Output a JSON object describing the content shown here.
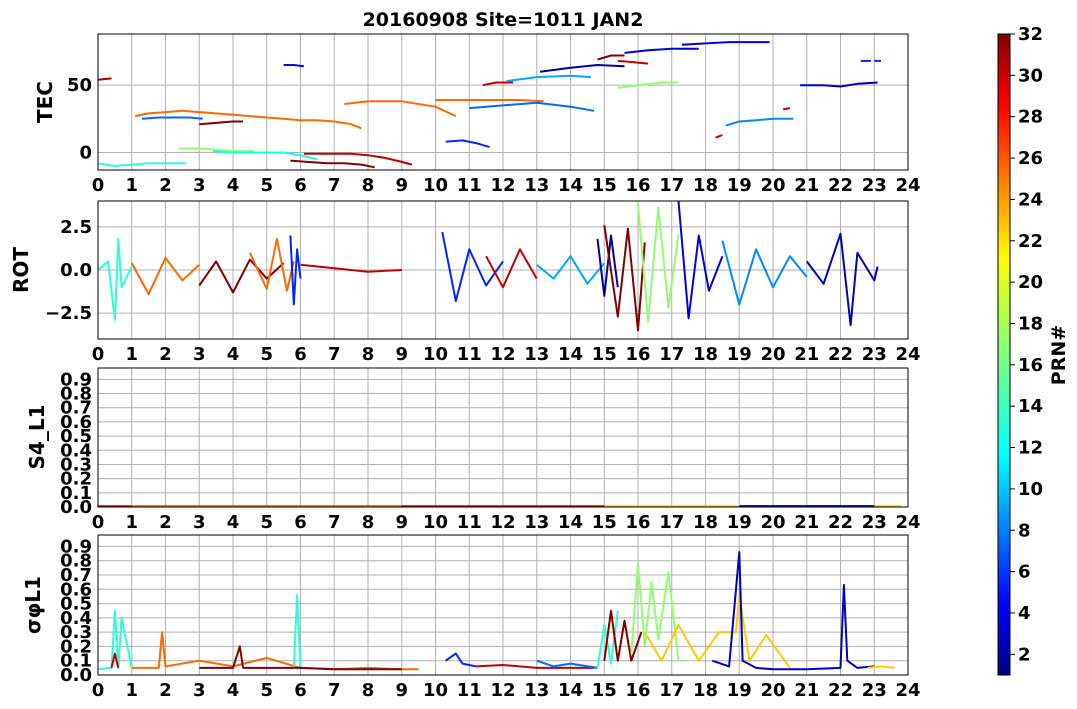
{
  "title": "20160908 Site=1011 JAN2",
  "colorbar": {
    "label": "PRN#",
    "range": [
      1,
      32
    ],
    "ticks": [
      "2",
      "4",
      "6",
      "8",
      "10",
      "12",
      "14",
      "16",
      "18",
      "20",
      "22",
      "24",
      "26",
      "28",
      "30",
      "32"
    ],
    "colormap": "jet"
  },
  "chart_data": [
    {
      "type": "line",
      "ylabel": "TEC",
      "xlim": [
        0,
        24
      ],
      "ylim": [
        -13,
        88
      ],
      "grid": true,
      "xticks": [
        "0",
        "1",
        "2",
        "3",
        "4",
        "5",
        "6",
        "7",
        "8",
        "9",
        "10",
        "11",
        "12",
        "13",
        "14",
        "15",
        "16",
        "17",
        "18",
        "19",
        "20",
        "21",
        "22",
        "23",
        "24"
      ],
      "yticks": [
        "0",
        "50"
      ],
      "ytick_values": [
        0,
        50
      ],
      "series": [
        {
          "prn": 31,
          "x": [
            0,
            0.4
          ],
          "y": [
            54,
            55
          ]
        },
        {
          "prn": 14,
          "x": [
            0,
            0.5,
            1,
            1.5,
            2,
            2.6
          ],
          "y": [
            -8,
            -10,
            -9,
            -8,
            -8,
            -8
          ]
        },
        {
          "prn": 25,
          "x": [
            1.1,
            1.5,
            2,
            2.5,
            3,
            3.5,
            4,
            4.5,
            5,
            5.5,
            6,
            6.5,
            7,
            7.5,
            7.8
          ],
          "y": [
            27,
            29,
            30,
            31,
            30,
            29,
            28,
            27,
            26,
            25,
            24,
            24,
            23,
            21,
            18
          ]
        },
        {
          "prn": 8,
          "x": [
            1.3,
            1.8,
            2.3,
            2.7,
            3.1
          ],
          "y": [
            25,
            26,
            26,
            26,
            25
          ]
        },
        {
          "prn": 32,
          "x": [
            3,
            3.5,
            4,
            4.3
          ],
          "y": [
            21,
            22,
            23,
            23
          ]
        },
        {
          "prn": 17,
          "x": [
            2.4,
            3,
            3.5,
            4,
            4.6
          ],
          "y": [
            3,
            3,
            2,
            1,
            1
          ]
        },
        {
          "prn": 13,
          "x": [
            3.4,
            4,
            5,
            5.5,
            6,
            6.5
          ],
          "y": [
            1,
            0,
            0,
            0,
            -2,
            -5
          ]
        },
        {
          "prn": 5,
          "x": [
            5.5,
            5.8,
            6.1
          ],
          "y": [
            65,
            65,
            64
          ]
        },
        {
          "prn": 32,
          "x": [
            5.7,
            6.2,
            6.8,
            7.3,
            7.8,
            8.2
          ],
          "y": [
            -6,
            -7,
            -8,
            -8,
            -9,
            -11
          ]
        },
        {
          "prn": 30,
          "x": [
            6.1,
            6.5,
            7,
            7.5,
            8,
            8.5,
            9,
            9.3
          ],
          "y": [
            -1,
            -1,
            -1,
            -1,
            -2,
            -4,
            -7,
            -9
          ]
        },
        {
          "prn": 25,
          "x": [
            7.3,
            8,
            9,
            10,
            10.6
          ],
          "y": [
            36,
            38,
            38,
            34,
            27
          ]
        },
        {
          "prn": 6,
          "x": [
            10.3,
            10.8,
            11.2,
            11.6
          ],
          "y": [
            8,
            9,
            7,
            4
          ]
        },
        {
          "prn": 25,
          "x": [
            10,
            11,
            12.5,
            13.2
          ],
          "y": [
            39,
            39,
            39,
            38
          ]
        },
        {
          "prn": 8,
          "x": [
            11,
            12,
            13,
            14,
            14.7
          ],
          "y": [
            33,
            35,
            37,
            34,
            31
          ]
        },
        {
          "prn": 30,
          "x": [
            11.4,
            11.8,
            12.3
          ],
          "y": [
            50,
            52,
            52
          ]
        },
        {
          "prn": 10,
          "x": [
            12.1,
            13,
            14,
            14.6
          ],
          "y": [
            53,
            56,
            57,
            56
          ]
        },
        {
          "prn": 2,
          "x": [
            13.1,
            14,
            14.8,
            15.6
          ],
          "y": [
            60,
            63,
            65,
            64
          ]
        },
        {
          "prn": 32,
          "x": [
            14.8,
            15.2,
            15.6
          ],
          "y": [
            69,
            72,
            72
          ]
        },
        {
          "prn": 30,
          "x": [
            15.4,
            15.9,
            16.3
          ],
          "y": [
            68,
            67,
            66
          ]
        },
        {
          "prn": 4,
          "x": [
            15.6,
            16.3,
            17,
            17.8
          ],
          "y": [
            74,
            76,
            77,
            77
          ]
        },
        {
          "prn": 17,
          "x": [
            15.4,
            16,
            16.7,
            17.2
          ],
          "y": [
            48,
            50,
            52,
            52
          ]
        },
        {
          "prn": 4,
          "x": [
            17.3,
            18,
            18.7,
            19.3,
            19.9
          ],
          "y": [
            80,
            81,
            82,
            82,
            82
          ]
        },
        {
          "prn": 30,
          "x": [
            18.3,
            18.5
          ],
          "y": [
            11,
            13
          ]
        },
        {
          "prn": 9,
          "x": [
            18.6,
            19,
            19.5,
            20,
            20.6
          ],
          "y": [
            20,
            23,
            24,
            25,
            25
          ]
        },
        {
          "prn": 30,
          "x": [
            20.3,
            20.5
          ],
          "y": [
            32,
            33
          ]
        },
        {
          "prn": 3,
          "x": [
            20.8,
            21.5,
            22,
            22.5,
            23.1
          ],
          "y": [
            50,
            50,
            49,
            51,
            52
          ]
        },
        {
          "prn": 6,
          "x": [
            22.6,
            22.9
          ],
          "y": [
            68,
            68
          ]
        },
        {
          "prn": 6,
          "x": [
            23,
            23.2
          ],
          "y": [
            68,
            68
          ]
        }
      ]
    },
    {
      "type": "line",
      "ylabel": "ROT",
      "xlim": [
        0,
        24
      ],
      "ylim": [
        -4,
        4
      ],
      "grid": true,
      "xticks": [
        "0",
        "1",
        "2",
        "3",
        "4",
        "5",
        "6",
        "7",
        "8",
        "9",
        "10",
        "11",
        "12",
        "13",
        "14",
        "15",
        "16",
        "17",
        "18",
        "19",
        "20",
        "21",
        "22",
        "23",
        "24"
      ],
      "yticks": [
        "2.5",
        "0.0",
        "−2.5"
      ],
      "ytick_values": [
        2.5,
        0,
        -2.5
      ],
      "series": [
        {
          "prn": 14,
          "x": [
            0,
            0.3,
            0.5,
            0.6,
            0.7,
            1
          ],
          "y": [
            0,
            0.5,
            -2.9,
            1.8,
            -1,
            0.2
          ]
        },
        {
          "prn": 25,
          "x": [
            1,
            1.5,
            2,
            2.5,
            3
          ],
          "y": [
            0.4,
            -1.4,
            0.7,
            -0.6,
            0.3
          ]
        },
        {
          "prn": 32,
          "x": [
            3,
            3.5,
            4,
            4.5,
            5,
            5.5
          ],
          "y": [
            -0.9,
            0.5,
            -1.3,
            0.6,
            -0.5,
            0.4
          ]
        },
        {
          "prn": 25,
          "x": [
            4.5,
            5,
            5.3,
            5.6,
            5.8
          ],
          "y": [
            1,
            -1.1,
            1.8,
            -1.2,
            0.5
          ]
        },
        {
          "prn": 6,
          "x": [
            5.7,
            5.8,
            5.9,
            6
          ],
          "y": [
            2,
            -2,
            1.2,
            -0.5
          ]
        },
        {
          "prn": 30,
          "x": [
            6,
            7,
            8,
            9
          ],
          "y": [
            0.3,
            0.1,
            -0.1,
            0
          ]
        },
        {
          "prn": 6,
          "x": [
            10.2,
            10.6,
            11,
            11.5,
            12
          ],
          "y": [
            2.2,
            -1.8,
            1.2,
            -0.9,
            0.5
          ]
        },
        {
          "prn": 30,
          "x": [
            11.5,
            12,
            12.5,
            13
          ],
          "y": [
            0.8,
            -1,
            1.2,
            -0.5
          ]
        },
        {
          "prn": 10,
          "x": [
            13,
            13.5,
            14,
            14.5,
            15
          ],
          "y": [
            0.3,
            -0.5,
            0.8,
            -0.8,
            0.4
          ]
        },
        {
          "prn": 2,
          "x": [
            14.8,
            15,
            15.2,
            15.4
          ],
          "y": [
            1.8,
            -1.5,
            2,
            -1
          ]
        },
        {
          "prn": 32,
          "x": [
            15,
            15.4,
            15.7,
            16,
            16.2
          ],
          "y": [
            2.6,
            -2.7,
            2.4,
            -3.5,
            1.6
          ]
        },
        {
          "prn": 17,
          "x": [
            16,
            16.3,
            16.6,
            16.9,
            17.2
          ],
          "y": [
            3.8,
            -3,
            3.6,
            -2.2,
            2.1
          ]
        },
        {
          "prn": 4,
          "x": [
            17.2,
            17.5,
            17.8,
            18.1,
            18.5
          ],
          "y": [
            4,
            -2.8,
            2,
            -1.2,
            0.8
          ]
        },
        {
          "prn": 9,
          "x": [
            18.5,
            19,
            19.5,
            20,
            20.5,
            21
          ],
          "y": [
            1.7,
            -2,
            1.2,
            -1,
            0.8,
            -0.4
          ]
        },
        {
          "prn": 3,
          "x": [
            21,
            21.5,
            22,
            22.3,
            22.5,
            23,
            23.1
          ],
          "y": [
            0.5,
            -0.8,
            2.1,
            -3.2,
            1,
            -0.6,
            0.2
          ]
        }
      ]
    },
    {
      "type": "line",
      "ylabel": "S4_L1",
      "xlim": [
        0,
        24
      ],
      "ylim": [
        0,
        0.98
      ],
      "grid": true,
      "xticks": [
        "0",
        "1",
        "2",
        "3",
        "4",
        "5",
        "6",
        "7",
        "8",
        "9",
        "10",
        "11",
        "12",
        "13",
        "14",
        "15",
        "16",
        "17",
        "18",
        "19",
        "20",
        "21",
        "22",
        "23",
        "24"
      ],
      "yticks": [
        "0.0",
        "0.1",
        "0.2",
        "0.3",
        "0.4",
        "0.5",
        "0.6",
        "0.7",
        "0.8",
        "0.9"
      ],
      "ytick_values": [
        0,
        0.1,
        0.2,
        0.3,
        0.4,
        0.5,
        0.6,
        0.7,
        0.8,
        0.9
      ],
      "series": [
        {
          "prn": 30,
          "x": [
            0,
            4,
            8,
            12,
            15
          ],
          "y": [
            0.005,
            0.005,
            0.005,
            0.005,
            0.005
          ]
        },
        {
          "prn": 25,
          "x": [
            1,
            5,
            9
          ],
          "y": [
            0.004,
            0.004,
            0.004
          ]
        },
        {
          "prn": 22,
          "x": [
            15,
            17,
            19,
            21,
            23,
            23.8
          ],
          "y": [
            0.005,
            0.005,
            0.005,
            0.005,
            0.005,
            0.005
          ]
        },
        {
          "prn": 3,
          "x": [
            19,
            21,
            23
          ],
          "y": [
            0.006,
            0.006,
            0.006
          ]
        }
      ]
    },
    {
      "type": "line",
      "ylabel": "σφL1",
      "xlim": [
        0,
        24
      ],
      "ylim": [
        0,
        0.98
      ],
      "grid": true,
      "xticks": [
        "0",
        "1",
        "2",
        "3",
        "4",
        "5",
        "6",
        "7",
        "8",
        "9",
        "10",
        "11",
        "12",
        "13",
        "14",
        "15",
        "16",
        "17",
        "18",
        "19",
        "20",
        "21",
        "22",
        "23",
        "24"
      ],
      "yticks": [
        "0.0",
        "0.1",
        "0.2",
        "0.3",
        "0.4",
        "0.5",
        "0.6",
        "0.7",
        "0.8",
        "0.9"
      ],
      "ytick_values": [
        0,
        0.1,
        0.2,
        0.3,
        0.4,
        0.5,
        0.6,
        0.7,
        0.8,
        0.9
      ],
      "series": [
        {
          "prn": 14,
          "x": [
            0,
            0.4,
            0.5,
            0.6,
            0.7,
            1
          ],
          "y": [
            0.04,
            0.05,
            0.45,
            0.05,
            0.4,
            0.05
          ]
        },
        {
          "prn": 30,
          "x": [
            0.4,
            0.5,
            0.6
          ],
          "y": [
            0.05,
            0.15,
            0.05
          ]
        },
        {
          "prn": 25,
          "x": [
            1,
            1.8,
            1.9,
            2,
            3,
            4,
            5,
            6,
            7,
            8,
            9,
            9.5
          ],
          "y": [
            0.05,
            0.05,
            0.3,
            0.06,
            0.1,
            0.06,
            0.12,
            0.05,
            0.04,
            0.05,
            0.04,
            0.04
          ]
        },
        {
          "prn": 14,
          "x": [
            5.8,
            5.9,
            6
          ],
          "y": [
            0.05,
            0.56,
            0.05
          ]
        },
        {
          "prn": 32,
          "x": [
            3,
            4,
            4.2,
            4.3,
            5,
            6,
            7,
            8,
            9
          ],
          "y": [
            0.05,
            0.05,
            0.2,
            0.05,
            0.05,
            0.05,
            0.04,
            0.04,
            0.04
          ]
        },
        {
          "prn": 6,
          "x": [
            10.3,
            10.6,
            10.8,
            11.2
          ],
          "y": [
            0.1,
            0.15,
            0.08,
            0.06
          ]
        },
        {
          "prn": 30,
          "x": [
            11.2,
            12,
            13,
            14,
            14.7
          ],
          "y": [
            0.06,
            0.07,
            0.05,
            0.05,
            0.05
          ]
        },
        {
          "prn": 8,
          "x": [
            13,
            13.5,
            14,
            14.8
          ],
          "y": [
            0.1,
            0.06,
            0.08,
            0.05
          ]
        },
        {
          "prn": 14,
          "x": [
            14.8,
            15,
            15.2,
            15.4
          ],
          "y": [
            0.05,
            0.35,
            0.08,
            0.45
          ]
        },
        {
          "prn": 32,
          "x": [
            15,
            15.2,
            15.4,
            15.6,
            15.8,
            16.1
          ],
          "y": [
            0.1,
            0.45,
            0.1,
            0.38,
            0.1,
            0.3
          ]
        },
        {
          "prn": 17,
          "x": [
            15.8,
            16,
            16.2,
            16.4,
            16.6,
            16.9,
            17.2
          ],
          "y": [
            0.15,
            0.78,
            0.2,
            0.65,
            0.25,
            0.72,
            0.1
          ]
        },
        {
          "prn": 22,
          "x": [
            16.2,
            16.7,
            17.2,
            17.8,
            18.4,
            18.9,
            19,
            19.3,
            19.8,
            20.5
          ],
          "y": [
            0.3,
            0.1,
            0.35,
            0.1,
            0.3,
            0.3,
            0.56,
            0.1,
            0.28,
            0.05
          ]
        },
        {
          "prn": 3,
          "x": [
            18.2,
            18.7,
            19,
            19.1,
            19.5,
            20,
            21,
            22,
            22.1,
            22.2,
            22.5,
            23
          ],
          "y": [
            0.1,
            0.06,
            0.86,
            0.1,
            0.05,
            0.04,
            0.04,
            0.05,
            0.63,
            0.1,
            0.05,
            0.06
          ]
        },
        {
          "prn": 22,
          "x": [
            22.8,
            23.2,
            23.6
          ],
          "y": [
            0.05,
            0.06,
            0.05
          ]
        }
      ]
    }
  ]
}
